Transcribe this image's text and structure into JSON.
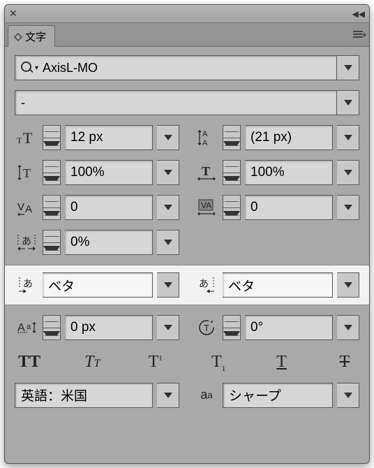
{
  "tab": {
    "label": "文字"
  },
  "font": {
    "family": "AxisL-MO",
    "style": "-"
  },
  "fontSize": {
    "value": "12 px"
  },
  "leading": {
    "value": "(21 px)"
  },
  "vscale": {
    "value": "100%"
  },
  "hscale": {
    "value": "100%"
  },
  "kerning": {
    "value": "0"
  },
  "tracking": {
    "value": "0"
  },
  "tsume": {
    "value": "0%"
  },
  "akiLeft": {
    "value": "ベタ"
  },
  "akiRight": {
    "value": "ベタ"
  },
  "baseline": {
    "value": "0 px"
  },
  "rotation": {
    "value": "0°"
  },
  "language": {
    "value": "英語：米国"
  },
  "antialias": {
    "value": "シャープ"
  }
}
